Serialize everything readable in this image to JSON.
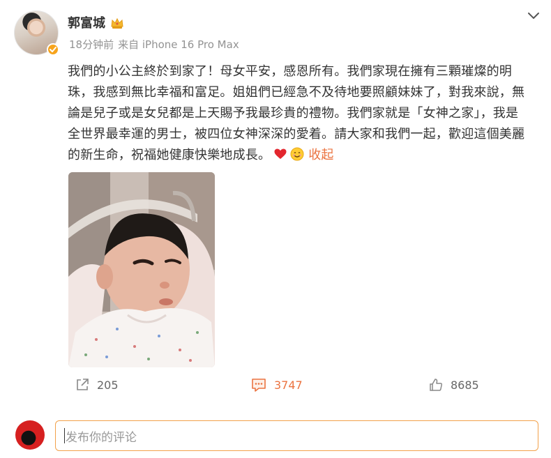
{
  "post": {
    "author": {
      "name": "郭富城",
      "avatar_icon": "user-avatar",
      "badge_icon": "verified-badge-icon",
      "crown_icon": "crown-icon"
    },
    "meta": {
      "time": "18分钟前",
      "source": "来自 iPhone 16 Pro Max"
    },
    "text_lines": [
      "我們的小公主終於到家了！母女平安，感恩所有。我們家現在擁有三顆璀燦的明",
      "珠，我感到無比幸福和富足。姐姐們已經急不及待地要照顧妹妹了，對我來說，無",
      "論是兒子或是女兒都是上天賜予我最珍貴的禮物。我們家就是「女神之家」，我是",
      "全世界最幸運的男士，被四位女神深深的愛着。請大家和我們一起，歡迎這個美麗",
      "的新生命，祝福她健康快樂地成長。"
    ],
    "emojis": [
      "heart-emoji",
      "smile-emoji"
    ],
    "collapse_label": "收起",
    "photo": {
      "subject": "newborn-baby-photo"
    },
    "actions": {
      "repost": {
        "icon": "share-icon",
        "count": "205"
      },
      "comment": {
        "icon": "comment-icon",
        "count": "3747"
      },
      "like": {
        "icon": "thumb-up-icon",
        "count": "8685"
      }
    }
  },
  "composer": {
    "placeholder": "发布你的评论",
    "avatar_icon": "my-avatar"
  },
  "colors": {
    "accent": "#eb7340",
    "meta": "#939393",
    "border_focus": "#f2a14a",
    "verified": "#f7a41c"
  }
}
